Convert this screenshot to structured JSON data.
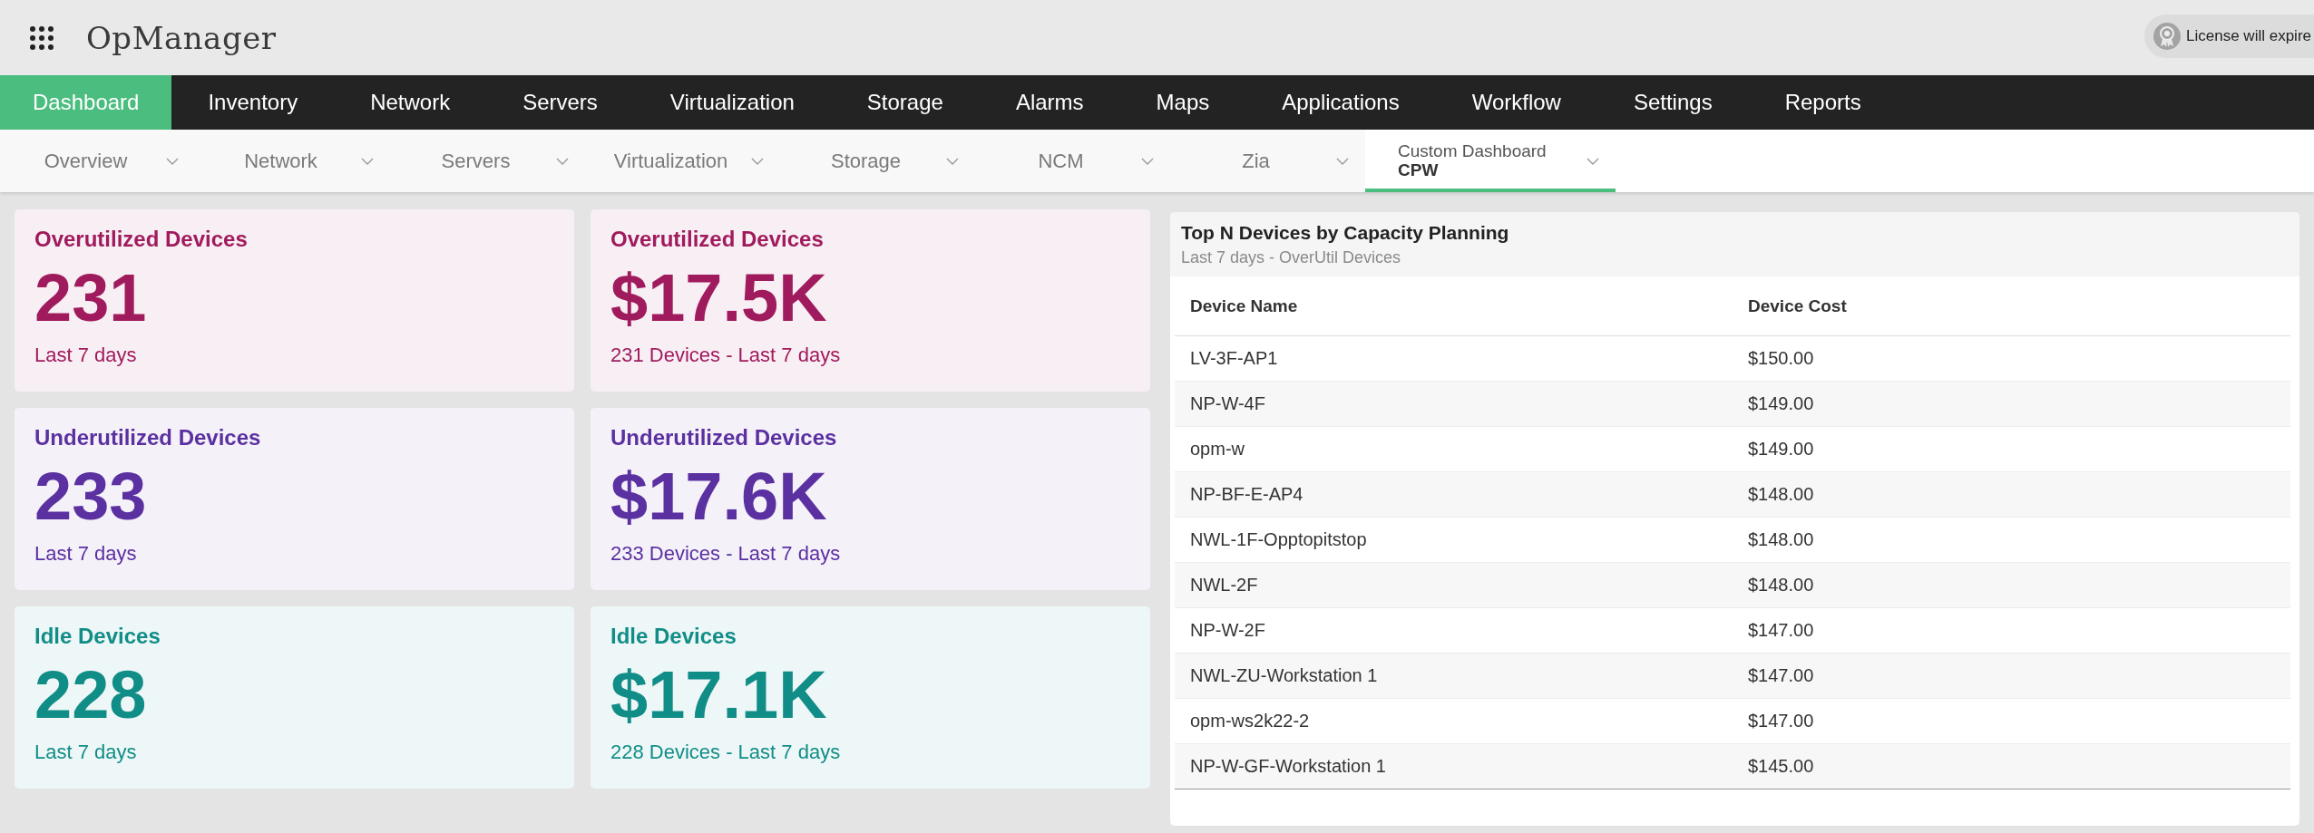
{
  "app": {
    "name": "OpManager"
  },
  "license": {
    "text": "License will expire"
  },
  "main_nav": [
    {
      "label": "Dashboard",
      "selected": true
    },
    {
      "label": "Inventory",
      "selected": false
    },
    {
      "label": "Network",
      "selected": false
    },
    {
      "label": "Servers",
      "selected": false
    },
    {
      "label": "Virtualization",
      "selected": false
    },
    {
      "label": "Storage",
      "selected": false
    },
    {
      "label": "Alarms",
      "selected": false
    },
    {
      "label": "Maps",
      "selected": false
    },
    {
      "label": "Applications",
      "selected": false
    },
    {
      "label": "Workflow",
      "selected": false
    },
    {
      "label": "Settings",
      "selected": false
    },
    {
      "label": "Reports",
      "selected": false
    }
  ],
  "sub_nav": [
    {
      "label": "Overview",
      "selected": false
    },
    {
      "label": "Network",
      "selected": false
    },
    {
      "label": "Servers",
      "selected": false
    },
    {
      "label": "Virtualization",
      "selected": false
    },
    {
      "label": "Storage",
      "selected": false
    },
    {
      "label": "NCM",
      "selected": false
    },
    {
      "label": "Zia",
      "selected": false
    },
    {
      "label": "Custom Dashboard",
      "value": "CPW",
      "selected": true
    }
  ],
  "cards": [
    {
      "title": "Overutilized Devices",
      "value": "231",
      "caption": "Last 7 days",
      "color": "#a01b5d"
    },
    {
      "title": "Overutilized Devices",
      "value": "$17.5K",
      "caption": "231 Devices - Last 7 days",
      "color": "#a01b5d"
    },
    {
      "title": "Underutilized Devices",
      "value": "233",
      "caption": "Last 7 days",
      "color": "#5b30a1"
    },
    {
      "title": "Underutilized Devices",
      "value": "$17.6K",
      "caption": "233 Devices - Last 7 days",
      "color": "#5b30a1"
    },
    {
      "title": "Idle Devices",
      "value": "228",
      "caption": "Last 7 days",
      "color": "#118d88"
    },
    {
      "title": "Idle Devices",
      "value": "$17.1K",
      "caption": "228 Devices - Last 7 days",
      "color": "#118d88"
    }
  ],
  "panel": {
    "title": "Top N Devices by Capacity Planning",
    "subtitle": "Last 7 days - OverUtil Devices",
    "columns": [
      "Device Name",
      "Device Cost"
    ],
    "rows": [
      {
        "name": "LV-3F-AP1",
        "cost": "$150.00"
      },
      {
        "name": "NP-W-4F",
        "cost": "$149.00"
      },
      {
        "name": "opm-w",
        "cost": "$149.00"
      },
      {
        "name": "NP-BF-E-AP4",
        "cost": "$148.00"
      },
      {
        "name": "NWL-1F-Opptopitstop",
        "cost": "$148.00"
      },
      {
        "name": "NWL-2F",
        "cost": "$148.00"
      },
      {
        "name": "NP-W-2F",
        "cost": "$147.00"
      },
      {
        "name": "NWL-ZU-Workstation 1",
        "cost": "$147.00"
      },
      {
        "name": "opm-ws2k22-2",
        "cost": "$147.00"
      },
      {
        "name": "NP-W-GF-Workstation 1",
        "cost": "$145.00"
      }
    ]
  }
}
